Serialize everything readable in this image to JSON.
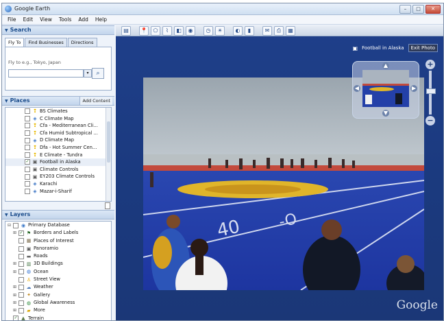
{
  "app": {
    "title": "Google Earth"
  },
  "window_buttons": [
    "–",
    "□",
    "✕"
  ],
  "menu": [
    "File",
    "Edit",
    "View",
    "Tools",
    "Add",
    "Help"
  ],
  "search": {
    "header": "Search",
    "tabs": [
      "Fly To",
      "Find Businesses",
      "Directions"
    ],
    "hint": "Fly to e.g., Tokyo, Japan",
    "value": "",
    "search_icon": "magnifier-icon"
  },
  "places": {
    "header": "Places",
    "add_content": "Add Content",
    "items": [
      {
        "label": "BS Climates",
        "checked": false,
        "icon": "pin-icon"
      },
      {
        "label": "C Climate Map",
        "checked": false,
        "icon": "overlay-icon"
      },
      {
        "label": "Cfa - Mediterranean Cli...",
        "checked": false,
        "icon": "pin-icon"
      },
      {
        "label": "Cfa Humid Subtropical ...",
        "checked": false,
        "icon": "pin-icon"
      },
      {
        "label": "D Climate Map",
        "checked": false,
        "icon": "overlay-icon"
      },
      {
        "label": "Dfa - Hot Summer Cen...",
        "checked": false,
        "icon": "pin-icon"
      },
      {
        "label": "E Climate - Tundra",
        "checked": false,
        "icon": "pin-icon"
      },
      {
        "label": "Football in Alaska",
        "checked": true,
        "icon": "photo-icon"
      },
      {
        "label": "Climate Controls",
        "checked": false,
        "icon": "photo-icon"
      },
      {
        "label": "EY203 Climate Controls",
        "checked": false,
        "icon": "photo-icon"
      },
      {
        "label": "Karachi",
        "checked": false,
        "icon": "overlay-icon"
      },
      {
        "label": "Mazar-i-Sharif",
        "checked": false,
        "icon": "overlay-icon"
      }
    ]
  },
  "layers": {
    "header": "Layers",
    "items": [
      {
        "label": "Primary Database",
        "checked": false,
        "expander": "⊟",
        "icon": "database-icon",
        "indent": 0
      },
      {
        "label": "Borders and Labels",
        "checked": true,
        "expander": "⊞",
        "icon": "flag-icon",
        "indent": 1
      },
      {
        "label": "Places of Interest",
        "checked": false,
        "expander": "",
        "icon": "poi-icon",
        "indent": 1
      },
      {
        "label": "Panoramio",
        "checked": false,
        "expander": "",
        "icon": "photo-icon",
        "indent": 1
      },
      {
        "label": "Roads",
        "checked": false,
        "expander": "",
        "icon": "road-icon",
        "indent": 1
      },
      {
        "label": "3D Buildings",
        "checked": false,
        "expander": "⊞",
        "icon": "building-icon",
        "indent": 1
      },
      {
        "label": "Ocean",
        "checked": false,
        "expander": "⊞",
        "icon": "ocean-icon",
        "indent": 1
      },
      {
        "label": "Street View",
        "checked": false,
        "expander": "",
        "icon": "pegman-icon",
        "indent": 1
      },
      {
        "label": "Weather",
        "checked": false,
        "expander": "⊞",
        "icon": "weather-icon",
        "indent": 1
      },
      {
        "label": "Gallery",
        "checked": false,
        "expander": "⊞",
        "icon": "gallery-icon",
        "indent": 1
      },
      {
        "label": "Global Awareness",
        "checked": false,
        "expander": "⊞",
        "icon": "globe-icon",
        "indent": 1
      },
      {
        "label": "More",
        "checked": false,
        "expander": "⊞",
        "icon": "folder-icon",
        "indent": 1
      },
      {
        "label": "Terrain",
        "checked": true,
        "expander": "",
        "icon": "terrain-icon",
        "indent": 0
      }
    ]
  },
  "viewer": {
    "breadcrumb": "Football in Alaska",
    "exit_photo": "Exit Photo",
    "logo": "Google"
  },
  "toolbar_icons": [
    "sidebar-toggle-icon",
    "placemark-icon",
    "polygon-icon",
    "path-icon",
    "image-overlay-icon",
    "record-tour-icon",
    "historical-imagery-icon",
    "sunlight-icon",
    "planets-icon",
    "ruler-icon",
    "email-icon",
    "print-icon",
    "view-in-maps-icon"
  ],
  "colors": {
    "field_blue": "#1f3fa8",
    "field_logo_gold": "#e0b52a",
    "accent": "#1c4d8c"
  }
}
